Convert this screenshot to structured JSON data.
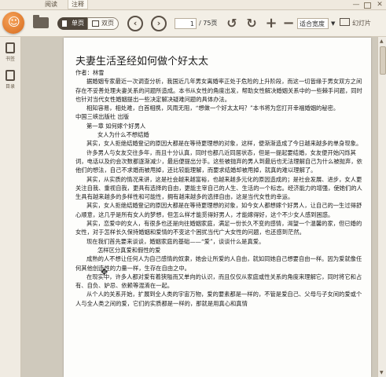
{
  "tabs": {
    "read": "阅读",
    "notes": "注释"
  },
  "window": {
    "minimize": "—",
    "close": "✕"
  },
  "toolbar": {
    "single_page": "单页",
    "double_page": "双页",
    "prev": "‹",
    "next": "›",
    "page_current": "1",
    "page_total": "/ 75页",
    "rotate_left": "↺",
    "rotate_right": "↻",
    "zoom_in": "+",
    "zoom_out": "−",
    "fit_mode": "适合宽度",
    "fit_arrow": "▼",
    "slideshow": "幻灯片"
  },
  "sidebar": {
    "bookmark": "书签",
    "toc": "目录"
  },
  "document": {
    "title": "夫妻生活圣经如何做个好太太",
    "author": "作者：林雪",
    "paragraphs": [
      {
        "style": "indent",
        "text": "据婚姻专家最近一次调查分析，我国近几年男女离婚率正处于危险的上升阶段，而这一切皆缘于男女双方之间存在不妥善处理夫妻关系的问题所造成。本书从女性的角度出发，帮助女性解决婚姻关系中的一些棘手问题，同时也针对当代女性婚姻提出一些决定解决疑难问题的具体办法。"
      },
      {
        "style": "indent",
        "text": "相知容易，相处难，白首相携，风雨无阻，“想做一个好太太吗？”本书将为您打开幸福婚姻的秘密。"
      },
      {
        "style": "plain",
        "text": "中国三峡出版社 出版"
      },
      {
        "style": "ind1",
        "text": "第一章 如何嫁个好男人"
      },
      {
        "style": "ind2",
        "text": "女人为什么不想结婚"
      },
      {
        "style": "indent",
        "text": "其实，女人拒绝结婚登记的原因大都是在等待更理想的对象，这样，便渐渐造成了今日越来越多的单身现象。"
      },
      {
        "style": "indent",
        "text": "许多男人与女友交往多年，而且十分认真，同时也都几近同居状态，但是一提起要结婚，女友便开始闪烁其词，电话以及约会次数都逐渐减少，最后便提出分手。这些被抛弃的男人到最后也无法理解自己为什么被抛弃，依他们的想法，自己不求婚而被甩掉，还比较能理解，而要求结婚却被甩掉，就真的难以理解了。"
      },
      {
        "style": "indent",
        "text": "其实，从实质的情况来讲，这是社会越来越富裕，也越来越多元化的原因造成的；是社会发展、进步，女人更关注自我、重视自我，更具有选择的自由，更能主宰自己的人生、生活的一个标志。经济能力的增强，使她们的人生具有越来越多的多样性和可能性，拥有越来越多的选择自由，这是当代女性的幸运。"
      },
      {
        "style": "indent",
        "text": "其实，女人拒绝结婚登记的原因大都是在等待更理想的对象，如今女人都想嫁个好男人，让自己的一生过得舒心顺意，这几乎是所有女人的梦想，但怎么样才能觅得好男人，才能嫁得好，这个不少女人感到困惑。"
      },
      {
        "style": "indent",
        "text": "其实，恋爱中的女人，有很多也还是向往婚姻家庭，满足一份长久不变的感情，渴望一个温馨的家，但已婚的女性，对于怎样长久保持婚姻和爱情的不变这个困扰当代广大女性的问题，也还感到茫然。"
      },
      {
        "style": "indent",
        "text": "现在我们首先要来谈谈，婚姻家庭的基础——“爱”，谈谈什么是真爱。"
      },
      {
        "style": "ind2",
        "text": "怎样区分真爱和假性的爱"
      },
      {
        "style": "indent",
        "text": "成熟的人不想让任何人为自己感情的奴隶，她会让所爱的人自由，就如同她自己想要自由一样。因为爱就像任何其他创造性的力量一样，生存在自由之中。"
      },
      {
        "style": "indent",
        "text": "在现实中，许多人都对爱有着狭隘而又单向的认识，而且仅仅从家庭或性关系的角度来理解它，同时将它和占有、自负、妒忌、依赖等混淆在一起。"
      },
      {
        "style": "indent",
        "text": "从个人的关系开始，扩展到全人类的宇宙万物，爱的要素都是一样的，不管是爱自己、父母与子女间的爱或个人与全人类之间的爱，它们的实质都是一样的，那就是用真心和真情"
      }
    ]
  }
}
